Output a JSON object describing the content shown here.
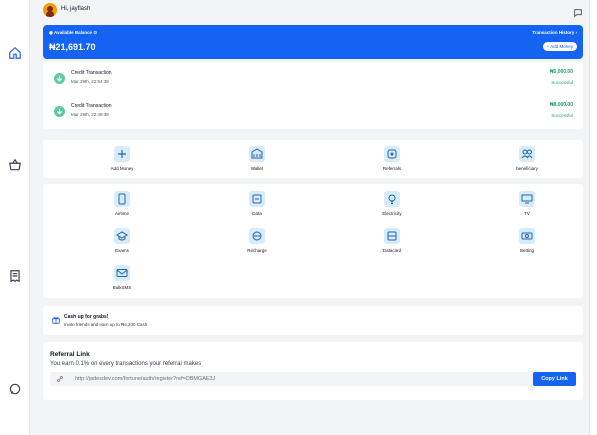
{
  "sidebar": {
    "icons": [
      "home-icon",
      "basket-icon",
      "receipt-icon",
      "support-icon"
    ]
  },
  "header": {
    "greeting": "Hi, jayflash",
    "message_icon": "chat-icon"
  },
  "balance": {
    "label": "Available Balance",
    "amount": "₦21,691.70",
    "history_link": "Transaction History",
    "add_money": "+ Add Money"
  },
  "transactions": [
    {
      "title": "Credit Transaction",
      "date": "Mar 29th, 22:54:38",
      "amount": "₦5,000.00",
      "status": "Successful"
    },
    {
      "title": "Credit Transaction",
      "date": "Mar 29th, 22:49:38",
      "amount": "₦8,000.00",
      "status": "Successful"
    }
  ],
  "quick_actions": [
    {
      "label": "Add Money",
      "icon": "plus-icon"
    },
    {
      "label": "Wallet",
      "icon": "wallet-icon"
    },
    {
      "label": "Referrals",
      "icon": "referral-icon"
    },
    {
      "label": "beneficiary",
      "icon": "users-icon"
    }
  ],
  "services": [
    {
      "label": "Airtime",
      "icon": "phone-icon"
    },
    {
      "label": "Data",
      "icon": "data-icon"
    },
    {
      "label": "Electricity",
      "icon": "bulb-icon"
    },
    {
      "label": "TV",
      "icon": "tv-icon"
    },
    {
      "label": "Exams",
      "icon": "exam-icon"
    },
    {
      "label": "Recharge",
      "icon": "recharge-icon"
    },
    {
      "label": "Datacard",
      "icon": "datacard-icon"
    },
    {
      "label": "Betting",
      "icon": "betting-icon"
    },
    {
      "label": "BulkSMS",
      "icon": "sms-icon"
    }
  ],
  "cash_banner": {
    "title": "Cash up for grabs!",
    "subtitle": "Invite friends and earn up to ₦4,200 Cash"
  },
  "referral": {
    "title": "Referral Link",
    "description": "You earn 0.1% on every transactions your referral makes",
    "url": "http://jadesdev.com/fortune/auth/register?ref=DBMGAE3J",
    "copy_label": "Copy Link"
  },
  "colors": {
    "primary": "#1463f3",
    "success": "#22a06b",
    "tile_bg": "#d6ecfb",
    "page_bg": "#f3f4f6"
  }
}
